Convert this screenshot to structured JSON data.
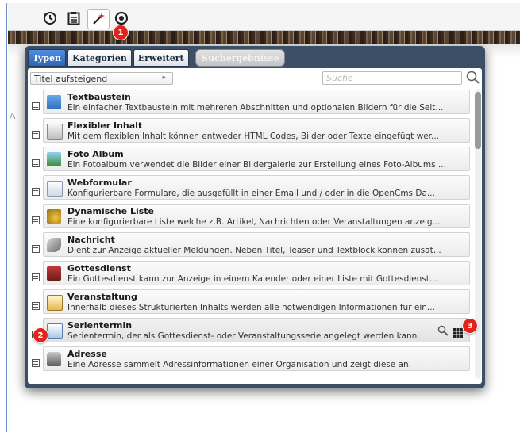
{
  "toolbar": {
    "icons": [
      "history-icon",
      "clipboard-icon",
      "magic-wand-icon",
      "target-icon"
    ]
  },
  "page": {
    "left_fragment": "A"
  },
  "badges": [
    "1",
    "2",
    "3"
  ],
  "tabs": [
    {
      "label": "Typen",
      "active": true
    },
    {
      "label": "Kategorien",
      "active": false
    },
    {
      "label": "Erweitert",
      "active": false
    }
  ],
  "results_tab": {
    "label": "Suchergebnisse"
  },
  "sort": {
    "value": "Titel aufsteigend"
  },
  "search": {
    "placeholder": "Suche"
  },
  "items": [
    {
      "title": "Textbaustein",
      "desc": "Ein einfacher Textbaustein mit mehreren Abschnitten und optionalen Bildern für die Seit...",
      "icon": "text-block-icon"
    },
    {
      "title": "Flexibler Inhalt",
      "desc": "Mit dem flexiblen Inhalt können entweder HTML Codes, Bilder oder Texte eingefügt wer...",
      "icon": "flexible-content-icon"
    },
    {
      "title": "Foto Album",
      "desc": "Ein Fotoalbum verwendet die Bilder einer Bildergalerie zur Erstellung eines Foto-Albums ...",
      "icon": "photo-album-icon"
    },
    {
      "title": "Webformular",
      "desc": "Konfigurierbare Formulare, die ausgefüllt in einer Email und / oder in die OpenCms Da...",
      "icon": "web-form-icon"
    },
    {
      "title": "Dynamische Liste",
      "desc": "Eine konfigurierbare Liste welche z.B. Artikel, Nachrichten oder Veranstaltungen anzeig...",
      "icon": "dynamic-list-icon"
    },
    {
      "title": "Nachricht",
      "desc": "Dient zur Anzeige aktueller Meldungen. Neben Titel, Teaser und Textblock können zusät...",
      "icon": "news-icon"
    },
    {
      "title": "Gottesdienst",
      "desc": "Ein Gottesdienst kann zur Anzeige in einem Kalender oder einer Liste mit Gottesdienst...",
      "icon": "church-service-icon"
    },
    {
      "title": "Veranstaltung",
      "desc": "Innerhalb dieses Strukturierten Inhalts werden alle notwendigen Informationen für ein...",
      "icon": "event-icon"
    },
    {
      "title": "Serientermin",
      "desc": "Serientermin, der als Gottesdienst- oder Veranstaltungsserie angelegt werden kann.",
      "icon": "series-event-icon"
    },
    {
      "title": "Adresse",
      "desc": "Eine Adresse sammelt Adressinformationen einer Organisation und zeigt diese an.",
      "icon": "address-icon"
    }
  ],
  "colors": {
    "dialog": "#3d4f66",
    "active_tab": "#2c66b8",
    "badge": "#e2231a"
  }
}
